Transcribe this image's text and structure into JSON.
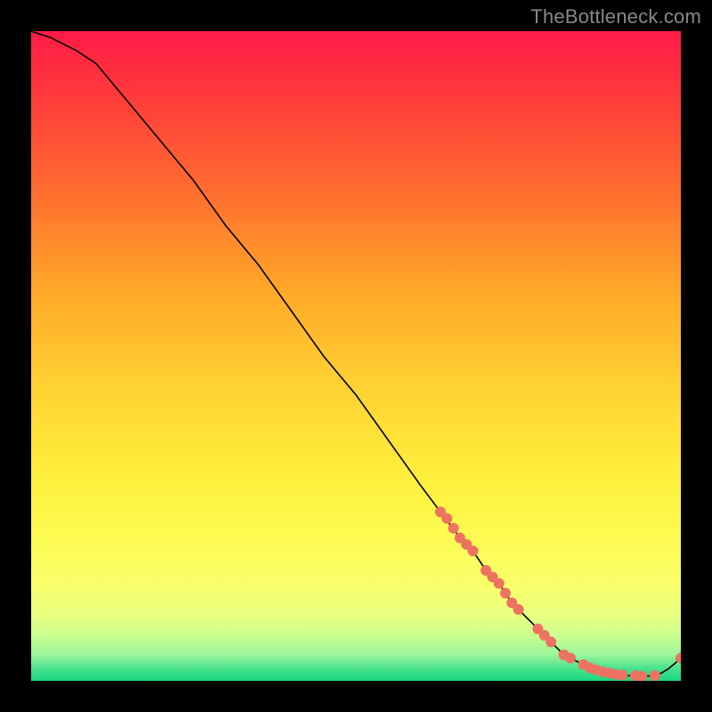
{
  "watermark": "TheBottleneck.com",
  "chart_data": {
    "type": "line",
    "title": "",
    "xlabel": "",
    "ylabel": "",
    "xlim": [
      0,
      100
    ],
    "ylim": [
      0,
      100
    ],
    "series": [
      {
        "name": "curve",
        "x": [
          0,
          3,
          7,
          10,
          15,
          20,
          25,
          30,
          35,
          40,
          45,
          50,
          55,
          60,
          63,
          66,
          68,
          70,
          72,
          74,
          76,
          78,
          80,
          82,
          84,
          86,
          88,
          90,
          92,
          94,
          96,
          97,
          98,
          99,
          100
        ],
        "values": [
          100,
          99,
          97,
          95,
          89,
          83,
          77,
          70,
          64,
          57,
          50,
          44,
          37,
          30,
          26,
          22,
          20,
          17,
          15,
          12,
          10,
          8,
          6,
          4,
          3,
          2,
          1.4,
          1,
          0.8,
          0.7,
          0.8,
          1.2,
          1.8,
          2.6,
          3.5
        ]
      }
    ],
    "markers": {
      "name": "dots",
      "points": [
        {
          "x": 63,
          "y": 26
        },
        {
          "x": 64,
          "y": 25
        },
        {
          "x": 65,
          "y": 23.5
        },
        {
          "x": 66,
          "y": 22
        },
        {
          "x": 67,
          "y": 21
        },
        {
          "x": 68,
          "y": 20
        },
        {
          "x": 70,
          "y": 17
        },
        {
          "x": 71,
          "y": 16
        },
        {
          "x": 72,
          "y": 15
        },
        {
          "x": 73,
          "y": 13.5
        },
        {
          "x": 74,
          "y": 12
        },
        {
          "x": 75,
          "y": 11
        },
        {
          "x": 78,
          "y": 8
        },
        {
          "x": 79,
          "y": 7
        },
        {
          "x": 80,
          "y": 6
        },
        {
          "x": 82,
          "y": 4
        },
        {
          "x": 83,
          "y": 3.5
        },
        {
          "x": 85,
          "y": 2.5
        },
        {
          "x": 86,
          "y": 2
        },
        {
          "x": 87,
          "y": 1.7
        },
        {
          "x": 88,
          "y": 1.4
        },
        {
          "x": 89,
          "y": 1.2
        },
        {
          "x": 90,
          "y": 1
        },
        {
          "x": 91,
          "y": 0.9
        },
        {
          "x": 93,
          "y": 0.8
        },
        {
          "x": 94,
          "y": 0.7
        },
        {
          "x": 96,
          "y": 0.8
        },
        {
          "x": 100,
          "y": 3.5
        }
      ]
    }
  },
  "colors": {
    "marker": "#ee7261",
    "curve": "#000000"
  }
}
